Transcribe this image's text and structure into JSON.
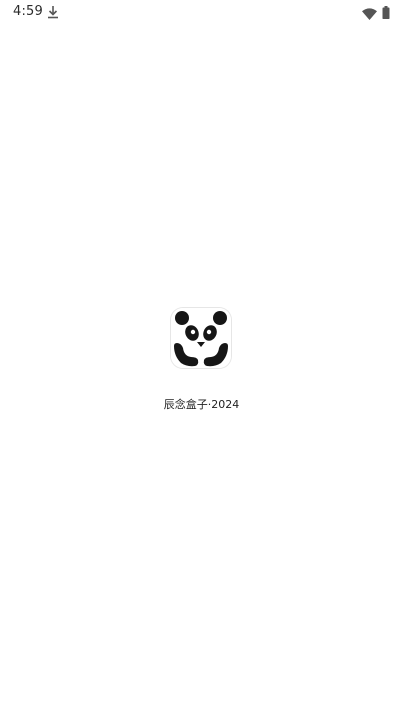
{
  "status_bar": {
    "time": "4:59",
    "icons": [
      "download-icon",
      "wifi-icon",
      "battery-icon"
    ]
  },
  "splash": {
    "logo_icon": "panda-logo-icon",
    "app_name": "辰念盒子·2024"
  },
  "colors": {
    "background": "#ffffff",
    "logo_dark": "#161616",
    "text": "#222222"
  }
}
